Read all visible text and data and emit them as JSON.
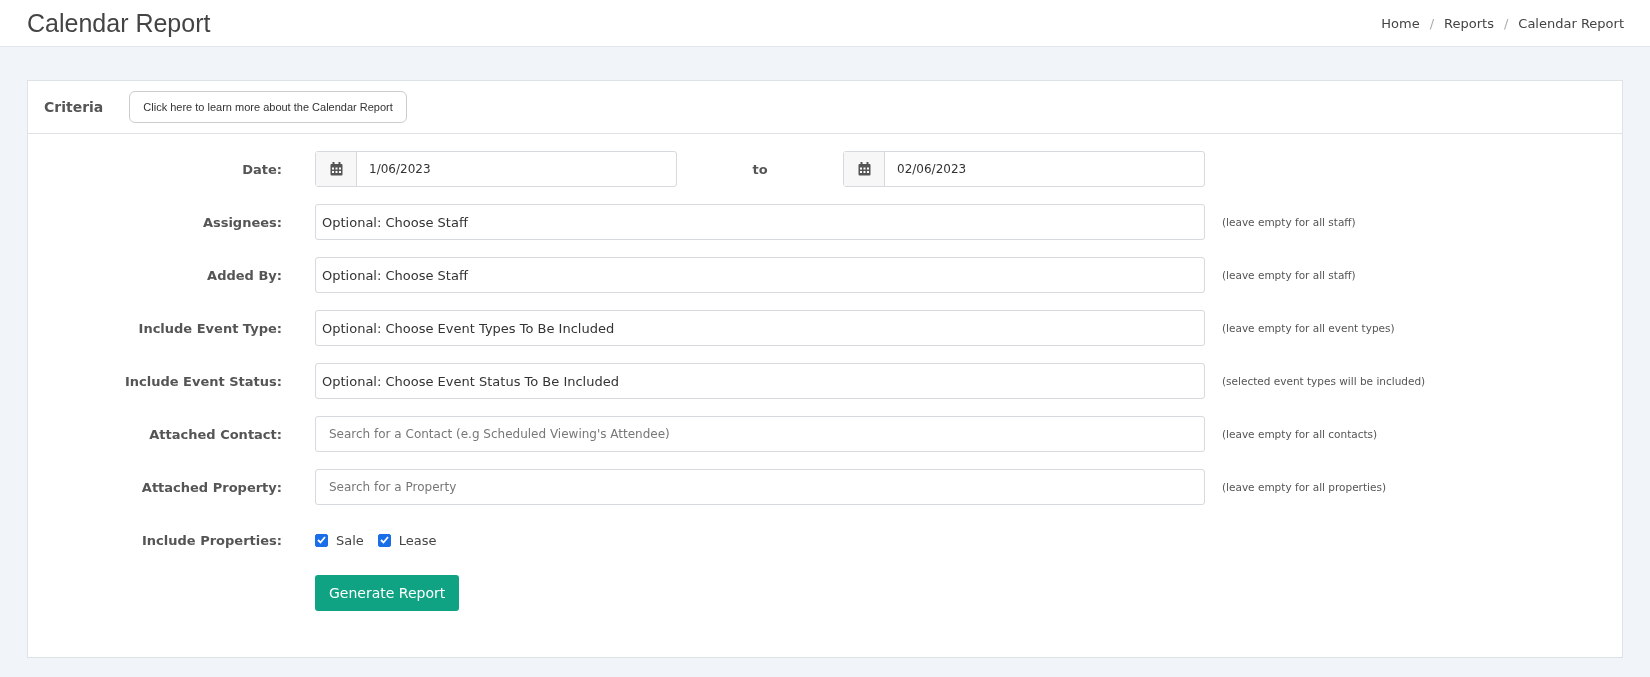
{
  "page": {
    "title": "Calendar Report"
  },
  "breadcrumb": [
    {
      "label": "Home"
    },
    {
      "separator": "/",
      "label": "Reports"
    },
    {
      "separator": "/",
      "label": "Calendar Report"
    }
  ],
  "criteria": {
    "title": "Criteria",
    "help_button": "Click here to learn more about the Calendar Report"
  },
  "rows": [
    {
      "kind": "date_range",
      "label": "Date:",
      "from": "1/06/2023",
      "separator": "to",
      "to": "02/06/2023"
    },
    {
      "kind": "select",
      "label": "Assignees:",
      "value": "Optional: Choose Staff",
      "hint": "(leave empty for all staff)"
    },
    {
      "kind": "select",
      "label": "Added By:",
      "value": "Optional: Choose Staff",
      "hint": "(leave empty for all staff)"
    },
    {
      "kind": "select",
      "label": "Include Event Type:",
      "value": "Optional: Choose Event Types To Be Included",
      "hint": "(leave empty for all event types)"
    },
    {
      "kind": "select",
      "label": "Include Event Status:",
      "value": "Optional: Choose Event Status To Be Included",
      "hint": "(selected event types will be included)"
    },
    {
      "kind": "search",
      "label": "Attached Contact:",
      "placeholder": "Search for a Contact (e.g Scheduled Viewing's Attendee)",
      "hint": "(leave empty for all contacts)"
    },
    {
      "kind": "search",
      "label": "Attached Property:",
      "placeholder": "Search for a Property",
      "hint": "(leave empty for all properties)"
    },
    {
      "kind": "checks",
      "label": "Include Properties:",
      "options": [
        {
          "label": "Sale",
          "checked": true
        },
        {
          "label": "Lease",
          "checked": true
        }
      ]
    }
  ],
  "submit": "Generate Report"
}
